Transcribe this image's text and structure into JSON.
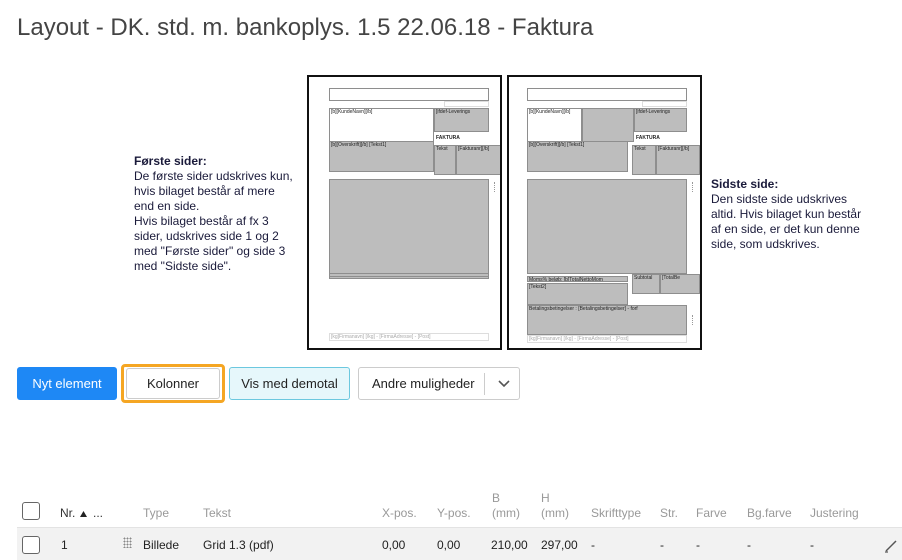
{
  "page": {
    "title": "Layout - DK. std. m. bankoplys. 1.5 22.06.18 - Faktura"
  },
  "previews": {
    "first": {
      "fields": {
        "kundenavn": "[b][KundeNavn][/b]",
        "levering": "[ifdef-Leverings",
        "faktura": "FAKTURA",
        "overskrift": "[b][Overskrift][/b] [Tekst1]",
        "tekst": "Tekst",
        "fakturanr": "[Fakturanr][/b]",
        "footer": "[kg]Firmanavn] [/kg] - [FirmaAdresse] - [Post]"
      }
    },
    "last": {
      "fields": {
        "kundenavn": "[b][KundeNavn][/b]",
        "levering": "[ifdef-Leverings",
        "faktura": "FAKTURA",
        "overskrift": "[b][Overskrift][/b] [Tekst1]",
        "tekst": "Tekst",
        "fakturanr": "[Fakturanr][/b]",
        "moms": "Moms% beløb: [b]TotalNettoMom",
        "subtotal": "Subtotal",
        "totalbe": "[TotalBe",
        "tekst2": "[Tekst2]",
        "betaling": "Betalingsbetingelser : [Betalingsbetingelser] - forf",
        "footer": "[kg]Firmanavn] [/kg] - [FirmaAdresse] - [Post]"
      }
    }
  },
  "descriptions": {
    "first": {
      "heading": "Første sider:",
      "body": "De første sider udskrives kun,\nhvis bilaget består af mere\nend en side.\nHvis bilaget består af fx 3\nsider, udskrives side 1 og 2\nmed \"Første sider\" og side 3\nmed \"Sidste side\"."
    },
    "last": {
      "heading": "Sidste side:",
      "body": "Den sidste side udskrives\naltid. Hvis bilaget kun består\naf en side, er det kun denne\nside, som udskrives."
    }
  },
  "toolbar": {
    "new_element": "Nyt element",
    "columns": "Kolonner",
    "show_demo": "Vis med demotal",
    "more_options": "Andre muligheder"
  },
  "table": {
    "headers": {
      "nr": "Nr.",
      "more": "...",
      "type": "Type",
      "tekst": "Tekst",
      "xpos": "X-pos.",
      "ypos": "Y-pos.",
      "b_top": "B",
      "b_bottom": "(mm)",
      "h_top": "H",
      "h_bottom": "(mm)",
      "font": "Skrifttype",
      "size": "Str.",
      "color": "Farve",
      "bgcolor": "Bg.farve",
      "align": "Justering"
    },
    "rows": [
      {
        "nr": "1",
        "type": "Billede",
        "tekst": "Grid 1.3 (pdf)",
        "xpos": "0,00",
        "ypos": "0,00",
        "b": "210,00",
        "h": "297,00",
        "font": "-",
        "size": "-",
        "color": "-",
        "bgcolor": "-",
        "align": "-"
      }
    ]
  },
  "colors": {
    "primary": "#1e88f5",
    "focus": "#f5a623",
    "demo_bg": "#e6f7fb"
  }
}
